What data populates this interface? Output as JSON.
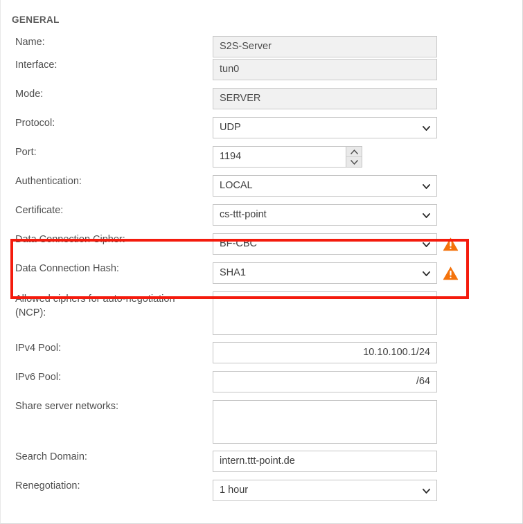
{
  "section": {
    "title": "GENERAL"
  },
  "colors": {
    "highlight_border": "#f41b0d",
    "warning_icon": "#f4720b",
    "label_text": "#4f4f4f",
    "field_border": "#c4c4c4",
    "disabled_field_bg": "#f1f1f1"
  },
  "icons": {
    "chevron_down": "chevron-down-icon",
    "spinner_up": "chevron-up-icon",
    "spinner_down": "chevron-down-icon",
    "warning": "warning-triangle-icon"
  },
  "fields": {
    "name": {
      "label": "Name:",
      "value": "S2S-Server",
      "type": "text",
      "readonly": true
    },
    "interface": {
      "label": "Interface:",
      "value": "tun0",
      "type": "text",
      "readonly": true
    },
    "mode": {
      "label": "Mode:",
      "value": "SERVER",
      "type": "text",
      "readonly": true
    },
    "protocol": {
      "label": "Protocol:",
      "value": "UDP",
      "type": "select"
    },
    "port": {
      "label": "Port:",
      "value": "1194",
      "type": "number"
    },
    "authentication": {
      "label": "Authentication:",
      "value": "LOCAL",
      "type": "select"
    },
    "certificate": {
      "label": "Certificate:",
      "value": "cs-ttt-point",
      "type": "select"
    },
    "data_connection_cipher": {
      "label": "Data Connection Cipher:",
      "value": "BF-CBC",
      "type": "select",
      "warning": true
    },
    "data_connection_hash": {
      "label": "Data Connection Hash:",
      "value": "SHA1",
      "type": "select",
      "warning": true
    },
    "allowed_ciphers_ncp": {
      "label": "Allowed ciphers for auto-negotiation (NCP):",
      "value": "",
      "type": "textarea"
    },
    "ipv4_pool": {
      "label": "IPv4 Pool:",
      "value": "10.10.100.1/24",
      "type": "text"
    },
    "ipv6_pool": {
      "label": "IPv6 Pool:",
      "value": "/64",
      "type": "text"
    },
    "share_server_networks": {
      "label": "Share server networks:",
      "value": "",
      "type": "textarea"
    },
    "search_domain": {
      "label": "Search Domain:",
      "value": "intern.ttt-point.de",
      "type": "text"
    },
    "renegotiation": {
      "label": "Renegotiation:",
      "value": "1 hour",
      "type": "select"
    }
  }
}
